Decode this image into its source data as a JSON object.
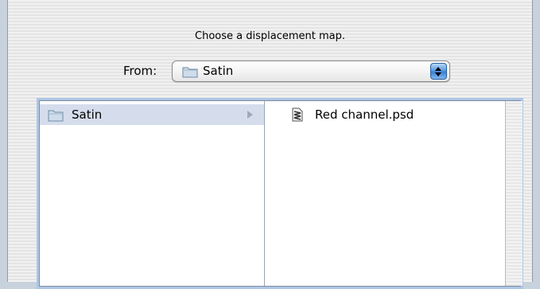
{
  "dialog": {
    "prompt": "Choose a displacement map."
  },
  "from": {
    "label": "From:",
    "selected": "Satin"
  },
  "browser": {
    "column1": [
      {
        "label": "Satin",
        "icon": "folder-icon",
        "selected": true
      }
    ],
    "column2": [
      {
        "label": "Red channel.psd",
        "icon": "psd-file-icon"
      }
    ]
  },
  "colors": {
    "selection": "#d5dded",
    "focus_ring": "#aec6e6",
    "popup_arrows": "#3b7fd3"
  }
}
